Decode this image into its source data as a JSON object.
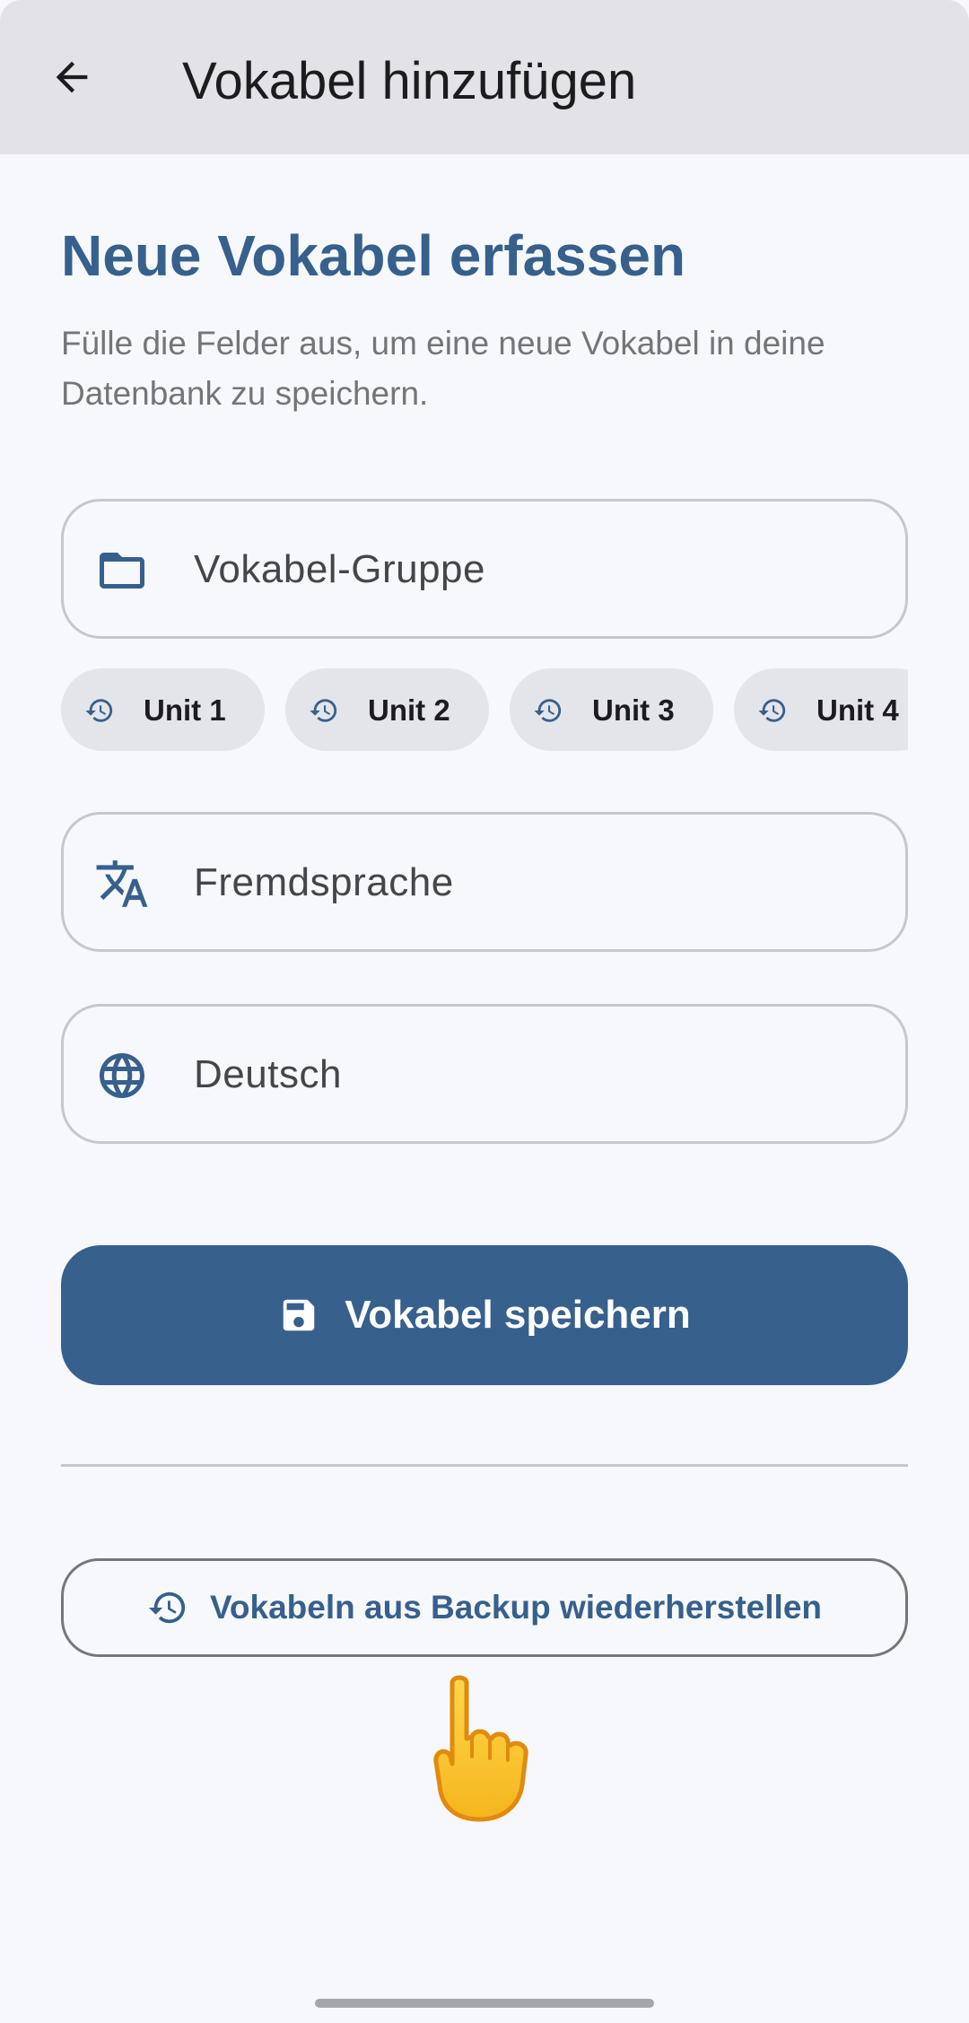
{
  "app_bar": {
    "title": "Vokabel hinzufügen",
    "back_icon": "arrow-back-icon"
  },
  "heading": "Neue Vokabel erfassen",
  "subtitle": "Fülle die Felder aus, um eine neue Vokabel in deine Datenbank zu speichern.",
  "fields": {
    "group": {
      "label": "Vokabel-Gruppe",
      "icon": "folder-icon"
    },
    "foreign": {
      "label": "Fremdsprache",
      "icon": "translate-icon"
    },
    "german": {
      "label": "Deutsch",
      "icon": "globe-icon"
    }
  },
  "recent_groups": [
    {
      "label": "Unit 1",
      "icon": "history-icon"
    },
    {
      "label": "Unit 2",
      "icon": "history-icon"
    },
    {
      "label": "Unit 3",
      "icon": "history-icon"
    },
    {
      "label": "Unit 4",
      "icon": "history-icon"
    }
  ],
  "save_button": {
    "label": "Vokabel speichern",
    "icon": "save-icon"
  },
  "restore_button": {
    "label": "Vokabeln aus Backup wiederherstellen",
    "icon": "restore-icon"
  },
  "colors": {
    "primary": "#37608c",
    "app_bar": "#e2e2e7",
    "background": "#f7f8fc",
    "chip": "#e4e5ea"
  }
}
